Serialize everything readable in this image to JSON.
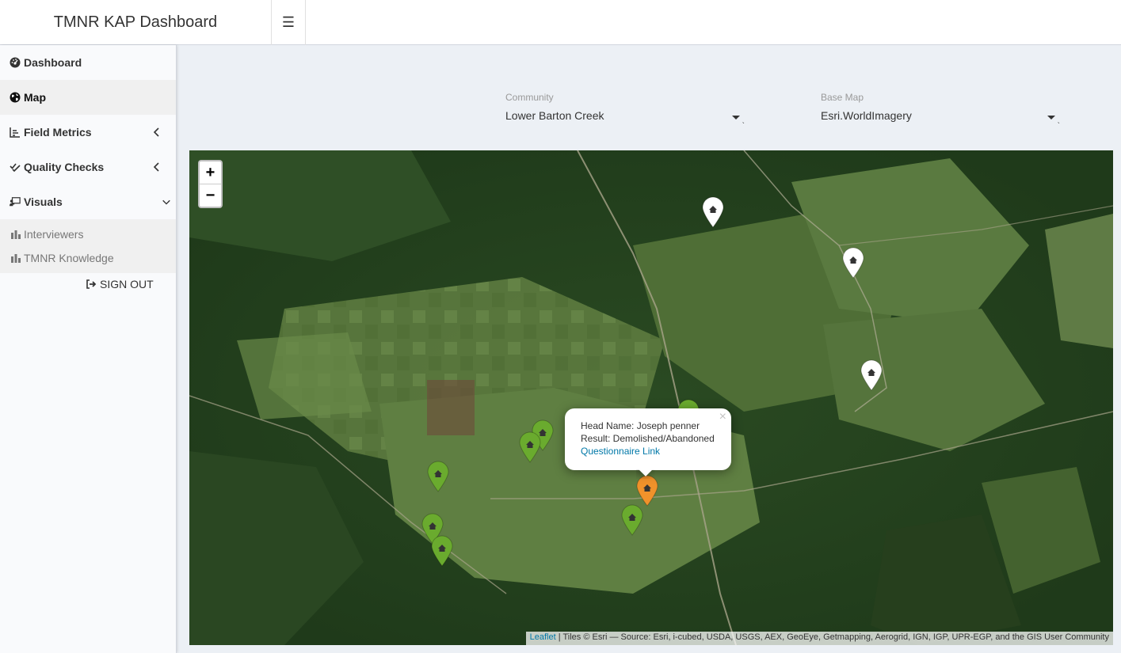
{
  "header": {
    "title": "TMNR KAP Dashboard",
    "menu_icon": "☰"
  },
  "sidebar": {
    "items": [
      {
        "label": "Dashboard",
        "icon": "dashboard-icon"
      },
      {
        "label": "Map",
        "icon": "globe-icon",
        "active": true
      },
      {
        "label": "Field Metrics",
        "icon": "chart-icon",
        "expandable": true
      },
      {
        "label": "Quality Checks",
        "icon": "double-check-icon",
        "expandable": true
      },
      {
        "label": "Visuals",
        "icon": "chalkboard-icon",
        "expanded": true
      }
    ],
    "sub_items": [
      {
        "label": "Interviewers",
        "icon": "bar-chart-icon"
      },
      {
        "label": "TMNR Knowledge",
        "icon": "bar-chart-icon"
      }
    ],
    "signout": "SIGN OUT"
  },
  "filters": {
    "community": {
      "label": "Community",
      "value": "Lower Barton Creek"
    },
    "basemap": {
      "label": "Base Map",
      "value": "Esri.WorldImagery"
    }
  },
  "map": {
    "zoom_in": "+",
    "zoom_out": "−",
    "popup": {
      "head_name": "Head Name: Joseph penner",
      "result": "Result: Demolished/Abandoned",
      "link": "Questionnaire Link",
      "close": "×"
    },
    "attribution_link": "Leaflet",
    "attribution_text": " | Tiles © Esri — Source: Esri, i-cubed, USDA, USGS, AEX, GeoEye, Getmapping, Aerogrid, IGN, IGP, UPR-EGP, and the GIS User Community",
    "marker_colors": {
      "white": "#ffffff",
      "green": "#6aab2e",
      "orange": "#f0922b"
    }
  }
}
